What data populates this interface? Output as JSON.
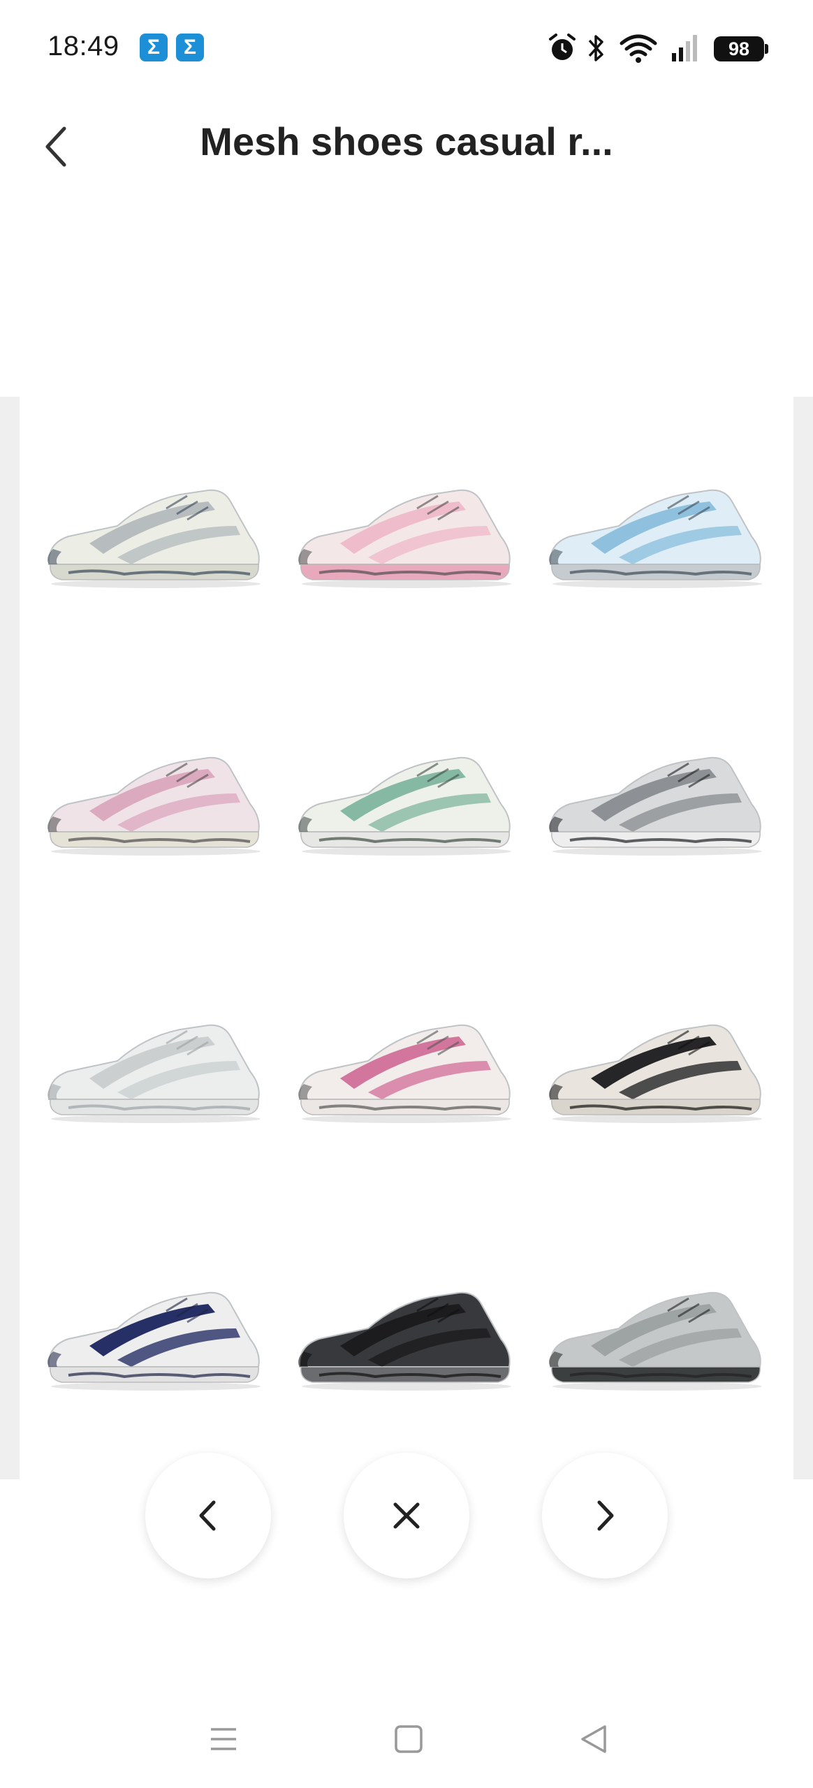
{
  "status_bar": {
    "time": "18:49",
    "app_badges": [
      "Σ",
      "Σ"
    ],
    "battery": "98",
    "badge_color": "#1d8fd6"
  },
  "header": {
    "title": "Mesh shoes casual r..."
  },
  "products": [
    {
      "upper": "#eceee6",
      "accent": "#b7bcbf",
      "sole": "#d7d9cf",
      "dark": "#3a4757"
    },
    {
      "upper": "#f4e7e7",
      "accent": "#efbccb",
      "sole": "#e9a9bd",
      "dark": "#4e4e4e"
    },
    {
      "upper": "#dfeef6",
      "accent": "#8fc0de",
      "sole": "#c6cbd0",
      "dark": "#3f4a55"
    },
    {
      "upper": "#f0e3e8",
      "accent": "#dcaabf",
      "sole": "#e5e2d6",
      "dark": "#4b4b4b"
    },
    {
      "upper": "#eef0ea",
      "accent": "#86b9a3",
      "sole": "#e7e8e6",
      "dark": "#3f4b45"
    },
    {
      "upper": "#d9dadc",
      "accent": "#8d9195",
      "sole": "#eeeeee",
      "dark": "#1e1f22"
    },
    {
      "upper": "#eceeee",
      "accent": "#cbcfcf",
      "sole": "#e3e5e5",
      "dark": "#9ea2a5"
    },
    {
      "upper": "#f2eceb",
      "accent": "#d3769d",
      "sole": "#ece7e4",
      "dark": "#555555"
    },
    {
      "upper": "#e9e4dd",
      "accent": "#262629",
      "sole": "#d9d5cc",
      "dark": "#111111"
    },
    {
      "upper": "#eeeeee",
      "accent": "#273066",
      "sole": "#e2e2e2",
      "dark": "#1c2244"
    },
    {
      "upper": "#38393c",
      "accent": "#1c1c1e",
      "sole": "#6b6c70",
      "dark": "#0f0f10"
    },
    {
      "upper": "#c5c8c8",
      "accent": "#9ea3a3",
      "sole": "#3c3f40",
      "dark": "#222222"
    }
  ],
  "controls": {
    "prev_icon": "chevron-left-icon",
    "close_icon": "close-icon",
    "next_icon": "chevron-right-icon"
  },
  "navigation": {
    "menu_icon": "menu-icon",
    "home_icon": "home-square-icon",
    "back_icon": "back-triangle-icon"
  }
}
